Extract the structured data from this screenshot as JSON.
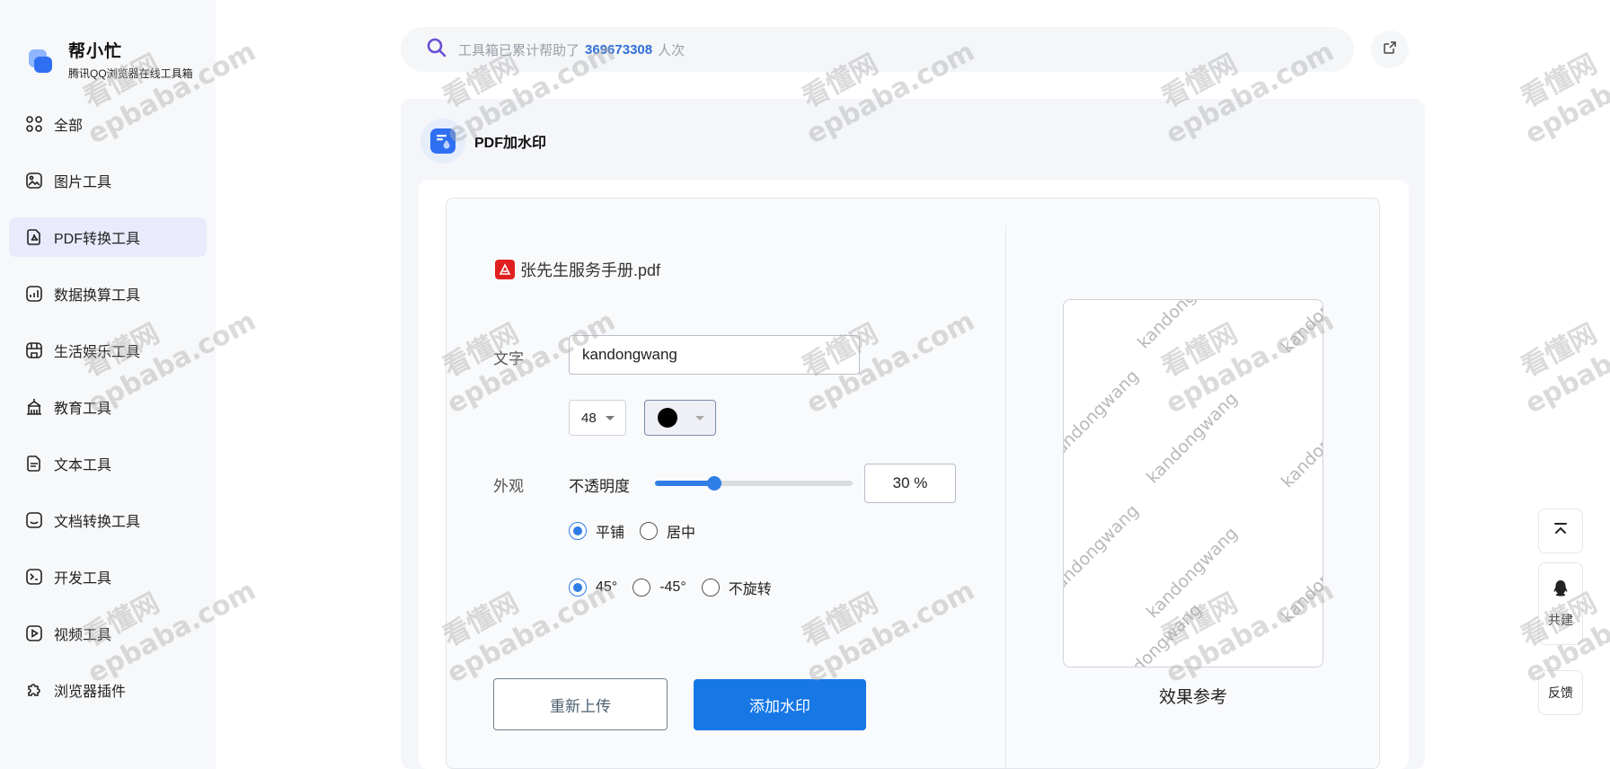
{
  "brand": {
    "title": "帮小忙",
    "subtitle": "腾讯QQ浏览器在线工具箱"
  },
  "sidebar": {
    "items": [
      {
        "label": "全部",
        "icon": "grid-icon"
      },
      {
        "label": "图片工具",
        "icon": "image-icon"
      },
      {
        "label": "PDF转换工具",
        "icon": "pdf-icon",
        "active": true
      },
      {
        "label": "数据换算工具",
        "icon": "chart-icon"
      },
      {
        "label": "生活娱乐工具",
        "icon": "store-icon"
      },
      {
        "label": "教育工具",
        "icon": "school-icon"
      },
      {
        "label": "文本工具",
        "icon": "text-doc-icon"
      },
      {
        "label": "文档转换工具",
        "icon": "doc-convert-icon"
      },
      {
        "label": "开发工具",
        "icon": "terminal-icon"
      },
      {
        "label": "视频工具",
        "icon": "video-icon"
      },
      {
        "label": "浏览器插件",
        "icon": "puzzle-icon"
      }
    ]
  },
  "search": {
    "prefix": "工具箱已累计帮助了",
    "count": "369673308",
    "suffix": "人次"
  },
  "tool": {
    "title": "PDF加水印"
  },
  "file": {
    "name": "张先生服务手册.pdf"
  },
  "form": {
    "text_label": "文字",
    "text_value": "kandongwang",
    "font_size": "48",
    "color": "#000000",
    "appearance_label": "外观",
    "opacity_label": "不透明度",
    "opacity_value": "30 %",
    "opacity_fraction": 0.3,
    "layout_options": [
      {
        "label": "平铺",
        "checked": true
      },
      {
        "label": "居中",
        "checked": false
      }
    ],
    "rotation_options": [
      {
        "label": "45°",
        "checked": true
      },
      {
        "label": "-45°",
        "checked": false
      },
      {
        "label": "不旋转",
        "checked": false
      }
    ],
    "reupload_label": "重新上传",
    "add_label": "添加水印"
  },
  "preview": {
    "caption": "效果参考",
    "watermark_text": "kandongwang"
  },
  "floating": {
    "top_icon": "back-to-top-icon",
    "qq_icon": "qq-icon",
    "cobuild_label": "共建",
    "feedback_label": "反馈"
  },
  "overlay_watermark": {
    "line1": "看懂网",
    "line2": "epbaba.com"
  },
  "colors": {
    "accent": "#1677e5",
    "active_nav": "#e9ebfc",
    "sidebar_bg": "#f7f8fa",
    "panel_bg": "#f5f6fa"
  }
}
